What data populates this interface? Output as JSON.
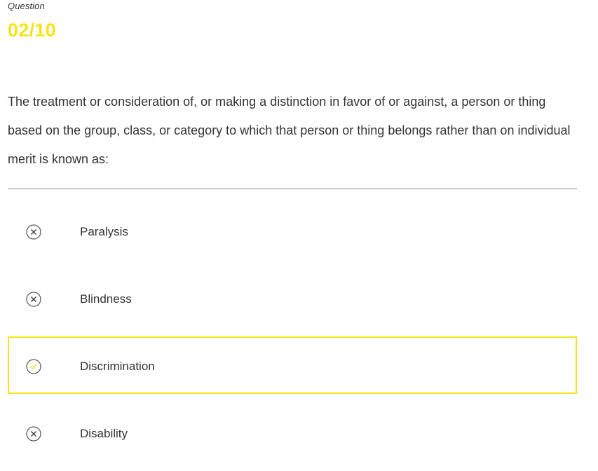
{
  "header": {
    "label": "Question",
    "number": "02/10"
  },
  "question": {
    "text": "The treatment or consideration of, or making a distinction in favor of or against, a person or thing based on the group, class, or category to which that person or thing belongs rather than on individual merit is known as:"
  },
  "options": [
    {
      "label": "Paralysis",
      "state": "incorrect",
      "icon": "x-circle-icon"
    },
    {
      "label": "Blindness",
      "state": "incorrect",
      "icon": "x-circle-icon"
    },
    {
      "label": "Discrimination",
      "state": "correct",
      "icon": "check-circle-icon"
    },
    {
      "label": "Disability",
      "state": "incorrect",
      "icon": "x-circle-icon"
    }
  ],
  "colors": {
    "accent": "#f5e418",
    "text": "#333333",
    "divider": "#8a8a8a"
  }
}
